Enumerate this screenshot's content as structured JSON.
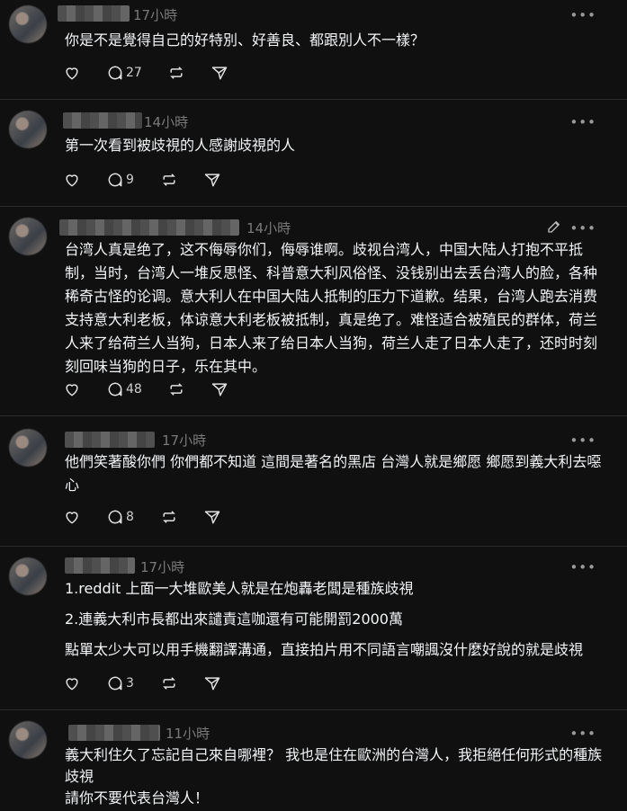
{
  "posts": [
    {
      "time": "17小時",
      "text": "你是不是覺得自己的好特別、好善良、都跟別人不一樣？",
      "reply_count": "27"
    },
    {
      "time": "14小時",
      "text": "第一次看到被歧視的人感謝歧視的人",
      "reply_count": "9"
    },
    {
      "time": "14小時",
      "text": "台湾人真是绝了，这不侮辱你们，侮辱谁啊。歧视台湾人，中国大陆人打抱不平抵制，当时，台湾人一堆反思怪、科普意大利风俗怪、没钱别出去丢台湾人的脸，各种稀奇古怪的论调。意大利人在中国大陆人抵制的压力下道歉。结果，台湾人跑去消费支持意大利老板，体谅意大利老板被抵制，真是绝了。难怪适合被殖民的群体，荷兰人来了给荷兰人当狗，日本人来了给日本人当狗，荷兰人走了日本人走了，还时时刻刻回味当狗的日子，乐在其中。",
      "reply_count": "48"
    },
    {
      "time": "17小時",
      "text": "他們笑著酸你們 你們都不知道 這間是著名的黑店 台灣人就是鄉愿 鄉愿到義大利去噁心",
      "reply_count": "8"
    },
    {
      "time": "17小時",
      "text_p1": "1.reddit 上面一大堆歐美人就是在炮轟老闆是種族歧視",
      "text_p2": "2.連義大利市長都出來譴責這咖還有可能開罰2000萬",
      "text_p3": "點單太少大可以用手機翻譯溝通，直接拍片用不同語言嘲諷沒什麼好說的就是歧視",
      "reply_count": "3"
    },
    {
      "time": "11小時",
      "text_p1": "義大利住久了忘記自己來自哪裡？ 我也是住在歐洲的台灣人，我拒絕任何形式的種族歧視",
      "text_p2": "請你不要代表台灣人！"
    }
  ],
  "icons": {
    "more": "more-icon",
    "edit": "edit-icon",
    "like": "heart-icon",
    "reply": "comment-icon",
    "repost": "repost-icon",
    "share": "share-icon"
  }
}
